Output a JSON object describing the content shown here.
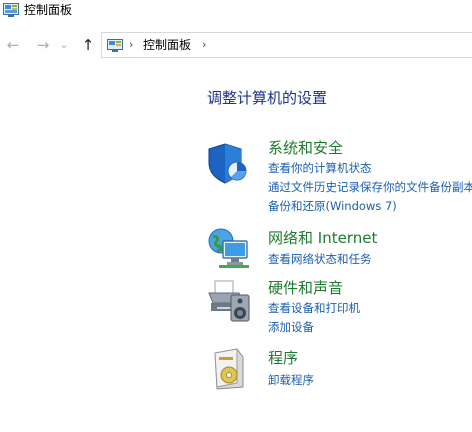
{
  "window": {
    "title": "控制面板"
  },
  "nav": {
    "back_glyph": "←",
    "forward_glyph": "→",
    "recent_glyph": "⌄",
    "up_glyph": "↑",
    "breadcrumb_sep": "›",
    "breadcrumb": "控制面板"
  },
  "main": {
    "heading": "调整计算机的设置",
    "categories": [
      {
        "title": "系统和安全",
        "icon": "shield-icon",
        "links": [
          "查看你的计算机状态",
          "通过文件历史记录保存你的文件备份副本",
          "备份和还原(Windows 7)"
        ]
      },
      {
        "title": "网络和 Internet",
        "icon": "network-icon",
        "links": [
          "查看网络状态和任务"
        ]
      },
      {
        "title": "硬件和声音",
        "icon": "printer-icon",
        "links": [
          "查看设备和打印机",
          "添加设备"
        ]
      },
      {
        "title": "程序",
        "icon": "programs-icon",
        "links": [
          "卸载程序"
        ]
      }
    ]
  },
  "colors": {
    "heading": "#1e3287",
    "category_title": "#1e7b2e",
    "link": "#1a5fb4"
  }
}
